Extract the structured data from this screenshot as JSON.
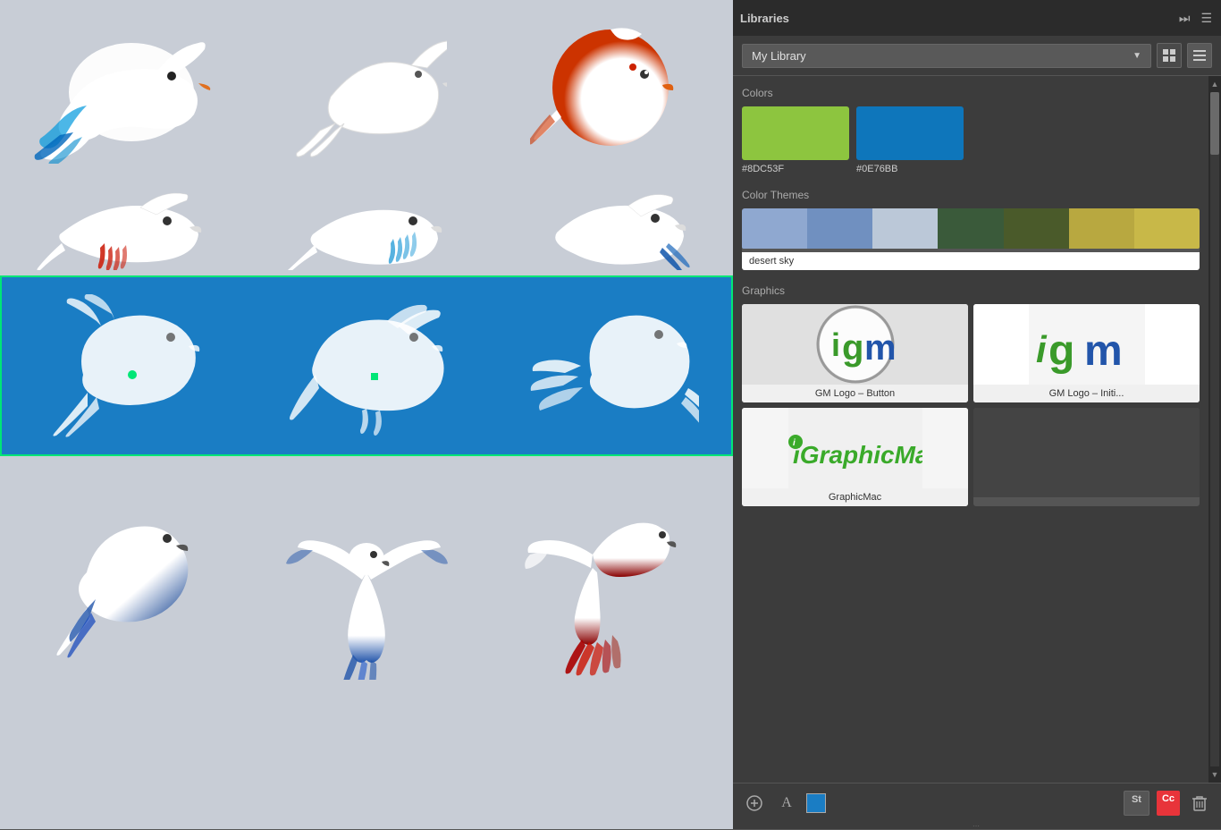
{
  "panel": {
    "title": "Libraries",
    "library_name": "My Library",
    "view_grid_label": "Grid View",
    "view_list_label": "List View"
  },
  "colors_section": {
    "label": "Colors",
    "swatches": [
      {
        "hex": "#8DC53F",
        "label": "#8DC53F"
      },
      {
        "hex": "#0E76BB",
        "label": "#0E76BB"
      }
    ]
  },
  "color_themes_section": {
    "label": "Color Themes",
    "themes": [
      {
        "name": "desert sky",
        "swatches": [
          "#8fa8d0",
          "#7090c0",
          "#3a5a3a",
          "#4a5a2a",
          "#b8a840",
          "#c8b848"
        ]
      }
    ]
  },
  "graphics_section": {
    "label": "Graphics",
    "items": [
      {
        "name": "GM Logo – Button",
        "type": "circle-logo"
      },
      {
        "name": "GM Logo – Initi...",
        "type": "text-logo"
      },
      {
        "name": "GraphicMac",
        "type": "brand-logo"
      },
      {
        "name": "",
        "type": "empty"
      }
    ]
  },
  "toolbar": {
    "add_graphic_label": "Add Graphic",
    "add_char_label": "Add Character",
    "add_color_label": "Add Color",
    "stock_label": "St",
    "cc_label": "Cc",
    "delete_label": "Delete"
  },
  "canvas": {
    "selected_row": 2
  }
}
